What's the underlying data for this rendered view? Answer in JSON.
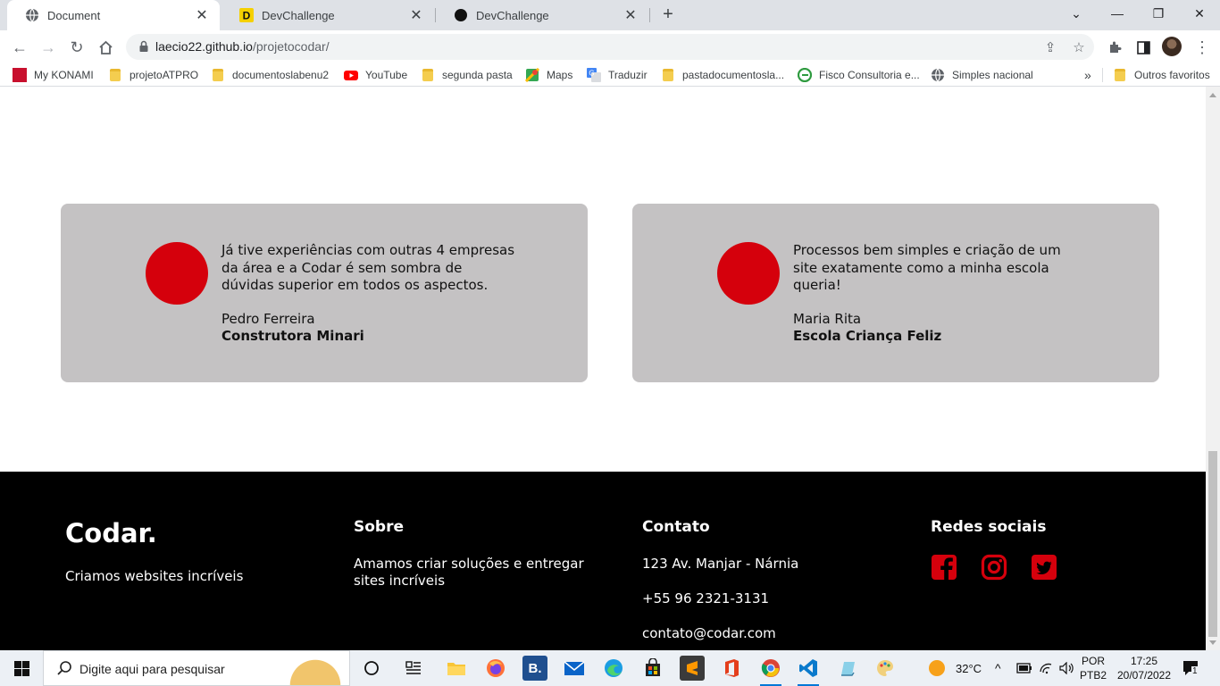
{
  "browser": {
    "tabs": [
      {
        "title": "Document",
        "active": true
      },
      {
        "title": "DevChallenge",
        "active": false
      },
      {
        "title": "DevChallenge",
        "active": false
      }
    ],
    "url_host": "laecio22.github.io",
    "url_path": "/projetocodar/",
    "bookmarks": [
      "My KONAMI",
      "projetoATPRO",
      "documentoslabenu2",
      "YouTube",
      "segunda pasta",
      "Maps",
      "Traduzir",
      "pastadocumentosla...",
      "Fisco Consultoria e...",
      "Simples nacional"
    ],
    "other_bookmarks": "Outros favoritos",
    "overflow": "»"
  },
  "testimonials": [
    {
      "quote": "Já tive experiências com outras 4 empresas da área e a Codar é sem sombra de dúvidas superior em todos os aspectos.",
      "author": "Pedro Ferreira",
      "company": "Construtora Minari"
    },
    {
      "quote": "Processos bem simples e criação de um site exatamente como a minha escola queria!",
      "author": "Maria Rita",
      "company": "Escola Criança Feliz"
    }
  ],
  "footer": {
    "brand": "Codar.",
    "tagline": "Criamos websites incríveis",
    "about_title": "Sobre",
    "about_text": "Amamos criar soluções e entregar sites incríveis",
    "contact_title": "Contato",
    "address": "123 Av. Manjar - Nárnia",
    "phone": "+55 96 2321-3131",
    "email": "contato@codar.com",
    "social_title": "Redes sociais",
    "social_icons": [
      "facebook-icon",
      "instagram-icon",
      "twitter-icon"
    ],
    "accent": "#d5000c"
  },
  "taskbar": {
    "search_placeholder": "Digite aqui para pesquisar",
    "weather": "32°C",
    "lang_line1": "POR",
    "lang_line2": "PTB2",
    "time": "17:25",
    "date": "20/07/2022",
    "notification_count": "1"
  }
}
